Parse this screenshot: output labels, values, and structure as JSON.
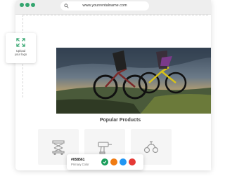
{
  "browser": {
    "url": "www.yourrentalname.com",
    "dot_color": "#34a56f"
  },
  "logo_upload": {
    "label_line1": "Upload",
    "label_line2": "your logo",
    "icon": "expand-arrows-icon",
    "icon_color": "#34a56f"
  },
  "hero": {
    "description_icon": "mountain-bikers-photo"
  },
  "products": {
    "title": "Popular Products",
    "items": [
      {
        "icon": "scissor-lift-icon"
      },
      {
        "icon": "power-drill-icon"
      },
      {
        "icon": "atv-icon"
      }
    ]
  },
  "primary_color": {
    "hex": "#058561",
    "label": "Primary Color",
    "swatches": [
      "#1a9e5c",
      "#f07b12",
      "#2196f3",
      "#e53935"
    ],
    "selected_index": 0
  }
}
